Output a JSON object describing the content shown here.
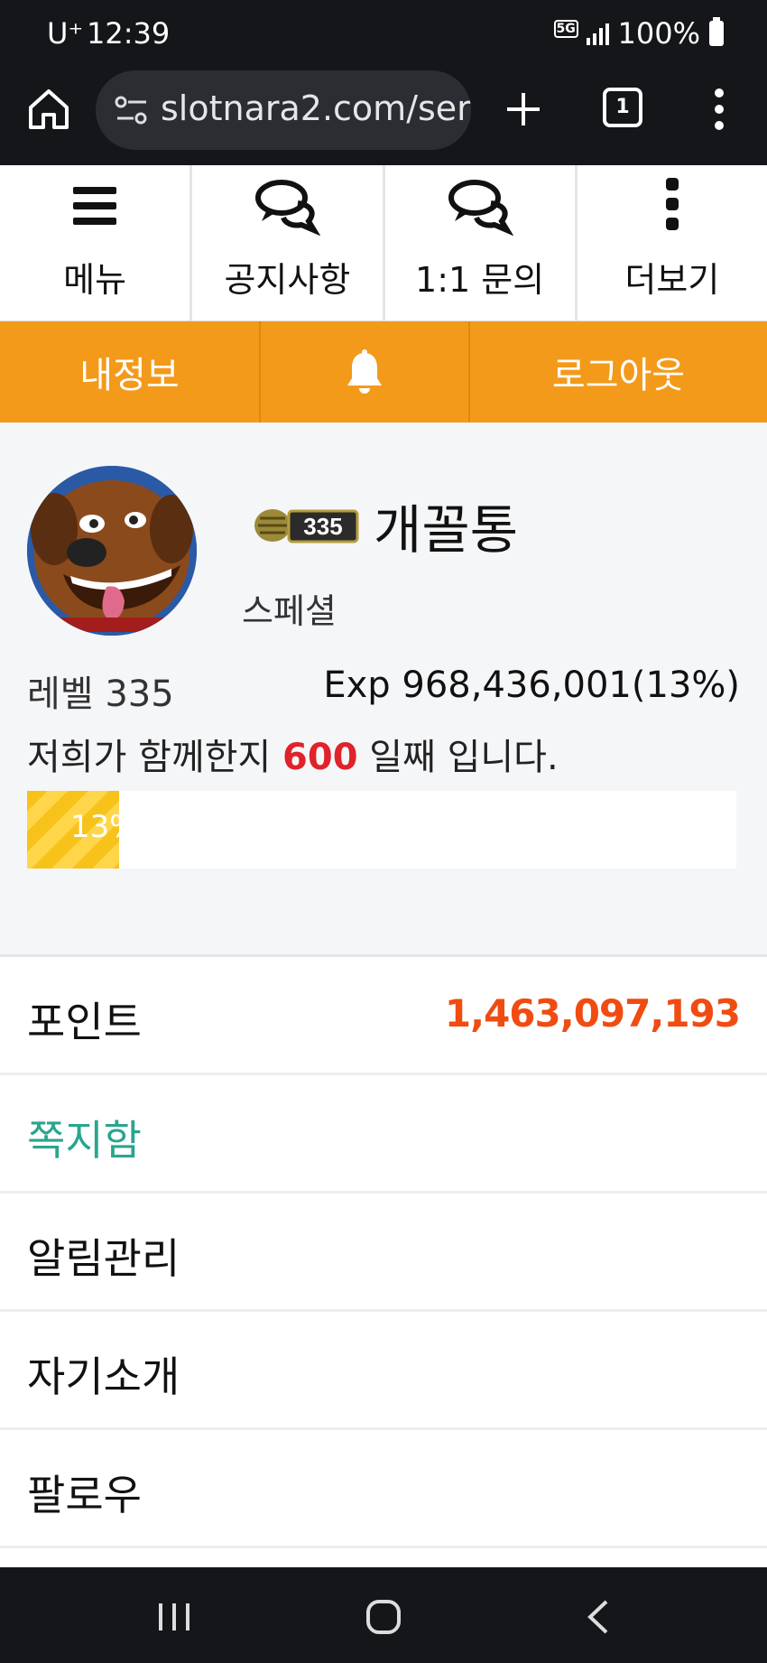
{
  "status_bar": {
    "carrier": "U⁺",
    "time": "12:39",
    "network": "5G",
    "battery": "100%"
  },
  "browser": {
    "url": "slotnara2.com/ser",
    "tab_count": "1"
  },
  "top_nav": [
    {
      "label": "메뉴",
      "icon": "hamburger-icon"
    },
    {
      "label": "공지사항",
      "icon": "chat-bubbles-icon"
    },
    {
      "label": "1:1 문의",
      "icon": "chat-bubbles-icon"
    },
    {
      "label": "더보기",
      "icon": "vertical-dots-icon"
    }
  ],
  "action_bar": {
    "my_info": "내정보",
    "notifications_icon": "bell-icon",
    "logout": "로그아웃",
    "color": "#f39a1b"
  },
  "profile": {
    "level_badge": "335",
    "nickname": "개꼴통",
    "grade": "스페셜",
    "level_text": "레벨 335",
    "exp_text": "Exp 968,436,001(13%)",
    "days_prefix": "저희가 함께한지",
    "days": "600",
    "days_suffix": "일째 입니다.",
    "progress_label": "13%",
    "progress_fraction": 0.13
  },
  "menu": {
    "points_label": "포인트",
    "points_value": "1,463,097,193",
    "messages": "쪽지함",
    "alerts": "알림관리",
    "intro": "자기소개",
    "follow": "팔로우"
  }
}
